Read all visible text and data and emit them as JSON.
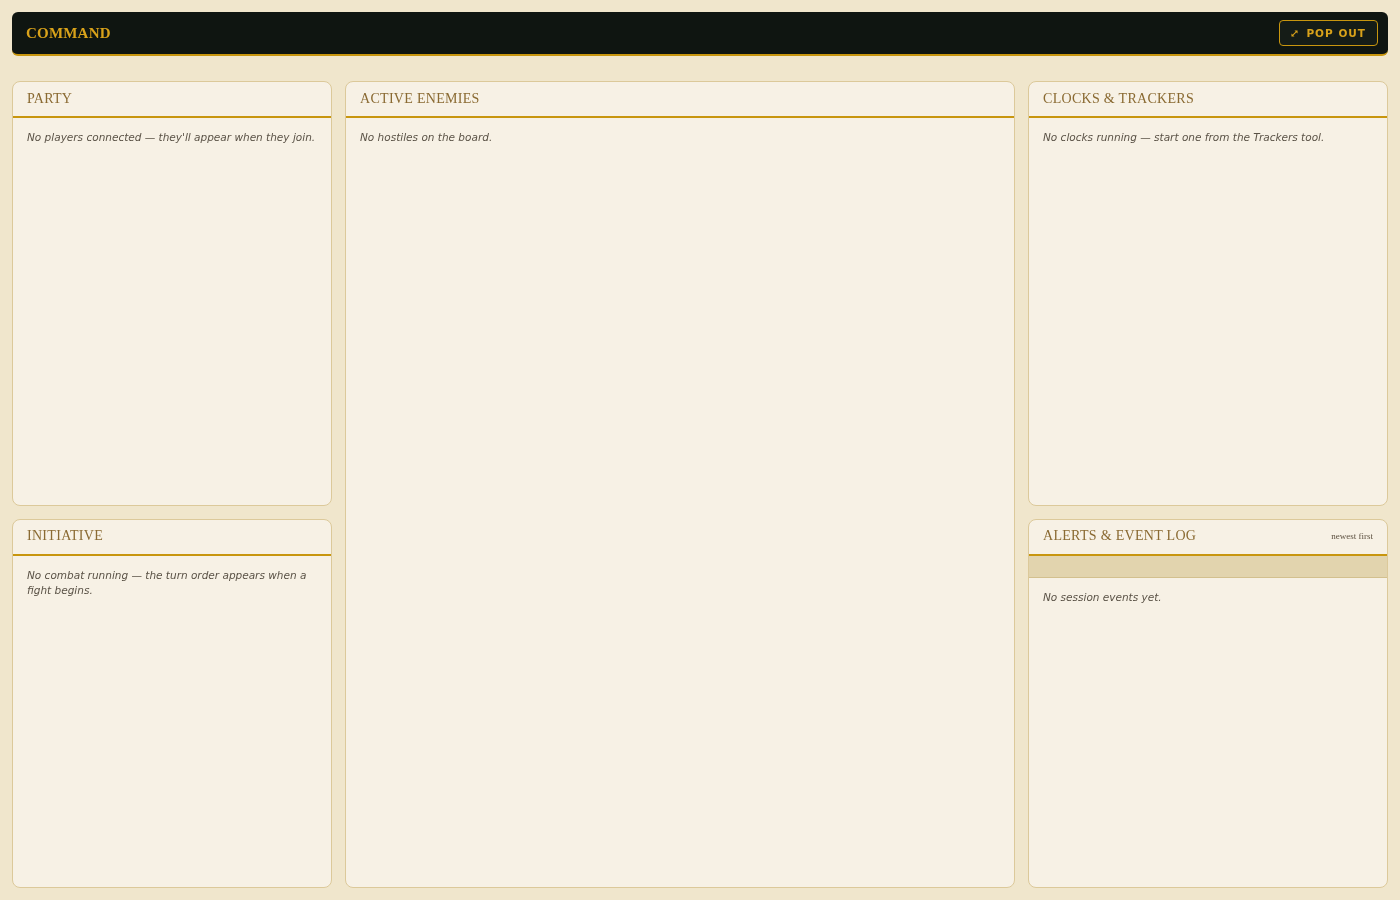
{
  "header": {
    "title": "COMMAND",
    "button": {
      "label": "POP OUT"
    }
  },
  "columns": [
    {
      "panels": [
        {
          "kind": "list",
          "title": "PARTY",
          "note": "No players connected — they'll appear when they join."
        },
        {
          "kind": "list",
          "title": "INITIATIVE",
          "note": "No combat running — the turn order appears when a fight begins."
        }
      ]
    },
    {
      "panels": [
        {
          "kind": "list",
          "title": "ACTIVE ENEMIES",
          "note": "No hostiles on the board."
        }
      ]
    },
    {
      "panels": [
        {
          "kind": "list",
          "title": "CLOCKS & TRACKERS",
          "note": "No clocks running — start one from the Trackers tool."
        },
        {
          "kind": "log",
          "title": "ALERTS & EVENT LOG",
          "meta": "newest first",
          "note": "No session events yet."
        }
      ]
    }
  ]
}
